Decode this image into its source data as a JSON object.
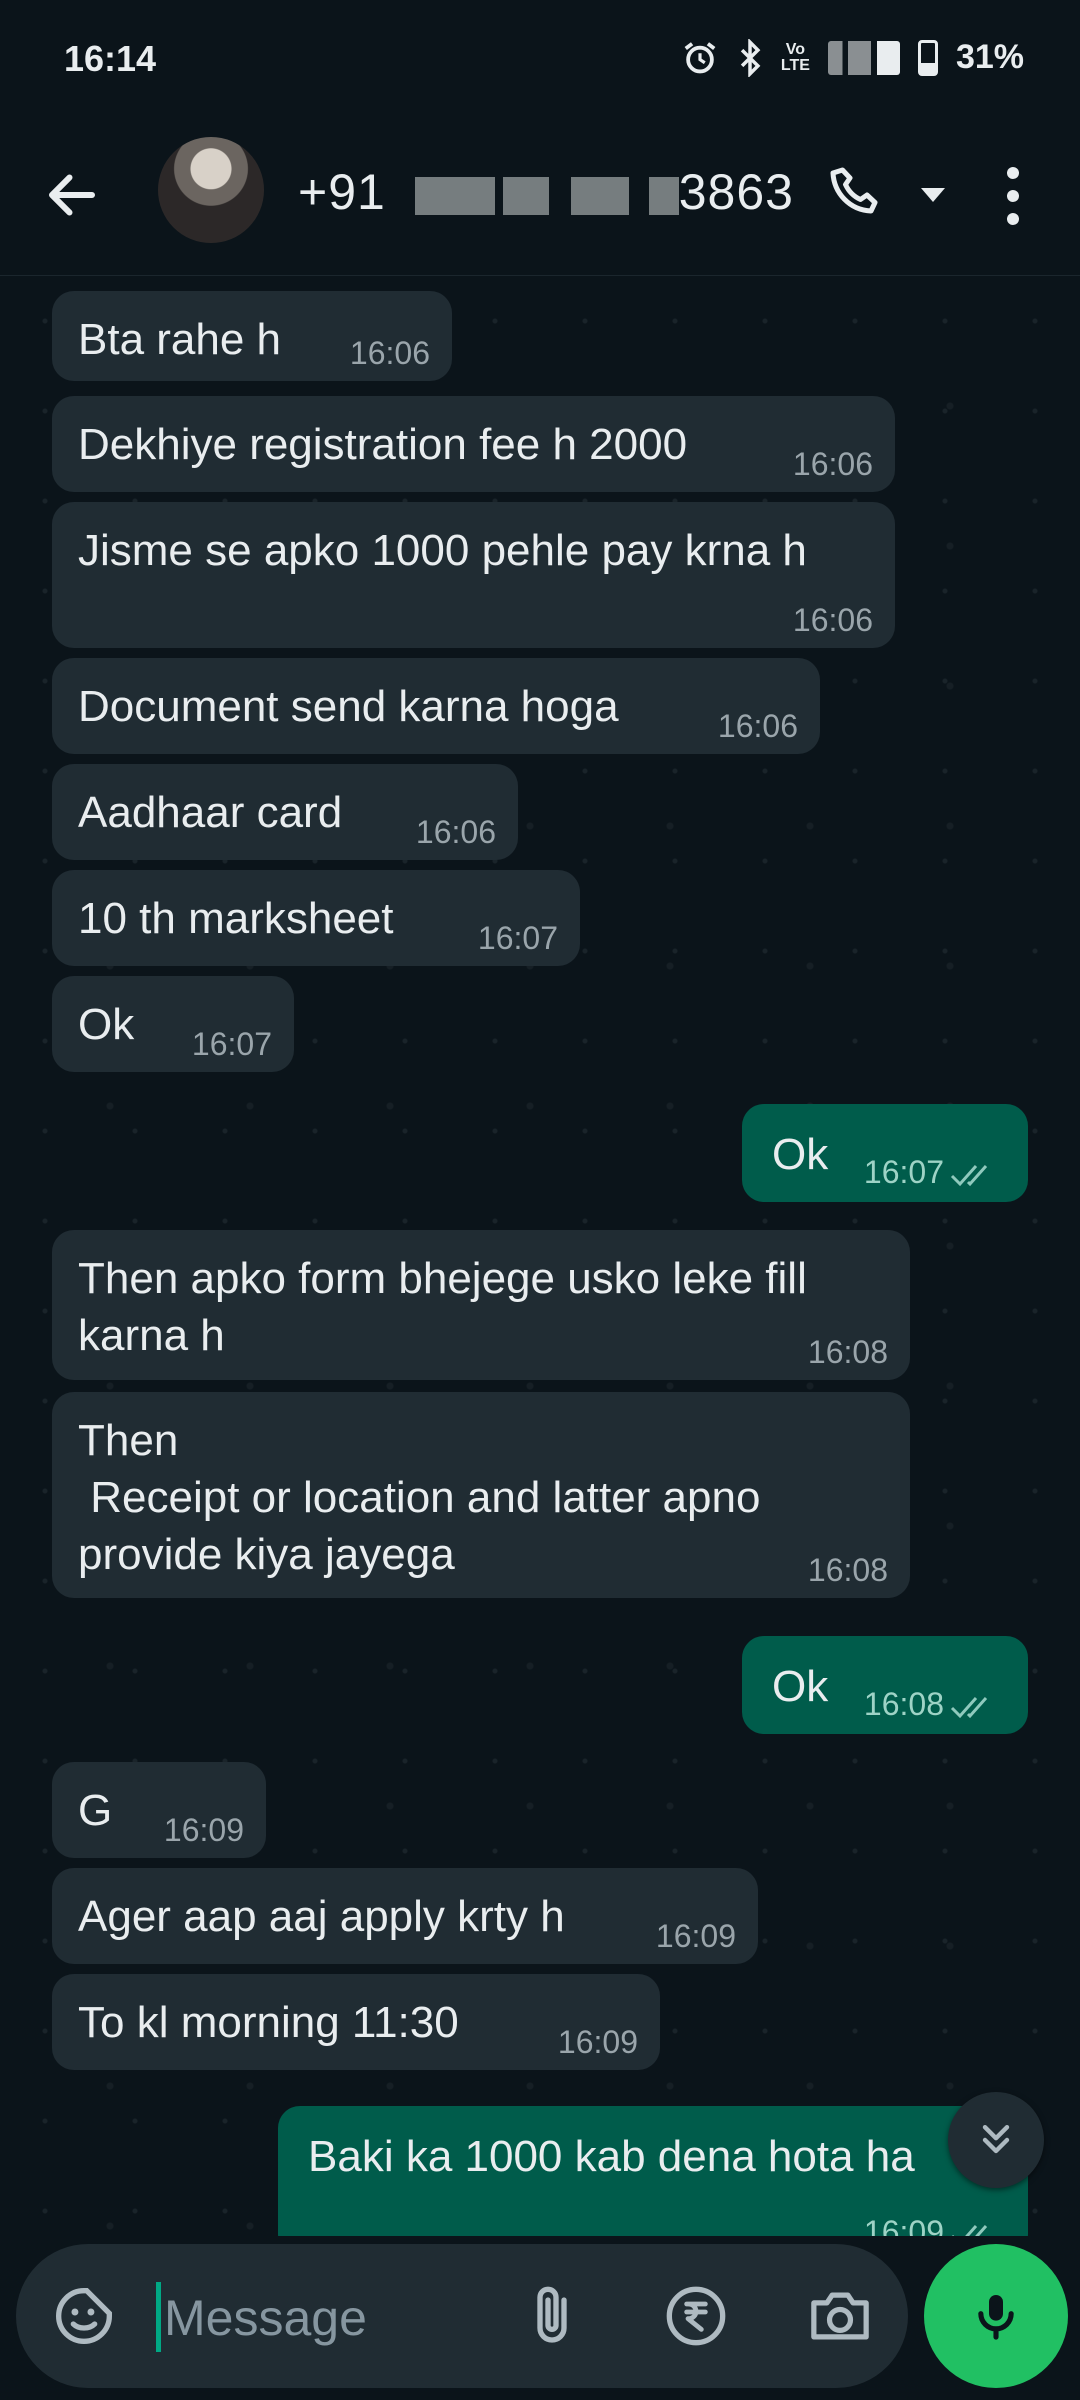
{
  "status_bar": {
    "time": "16:14",
    "volte": "Vo\nLTE",
    "battery": "31%"
  },
  "header": {
    "contact_prefix": "+91",
    "contact_suffix": "3863"
  },
  "composer": {
    "placeholder": "Message"
  },
  "colors": {
    "incoming_bubble": "#202c33",
    "outgoing_bubble": "#005c4b",
    "accent": "#21c063"
  },
  "messages": [
    {
      "dir": "in",
      "text": "Bta rahe h",
      "time": "16:06"
    },
    {
      "dir": "in",
      "text": "Dekhiye registration fee h 2000",
      "time": "16:06"
    },
    {
      "dir": "in",
      "text": "Jisme se apko 1000 pehle pay krna h",
      "time": "16:06"
    },
    {
      "dir": "in",
      "text": "Document send karna hoga",
      "time": "16:06"
    },
    {
      "dir": "in",
      "text": "Aadhaar card",
      "time": "16:06"
    },
    {
      "dir": "in",
      "text": "10 th marksheet",
      "time": "16:07"
    },
    {
      "dir": "in",
      "text": "Ok",
      "time": "16:07"
    },
    {
      "dir": "out",
      "text": "Ok",
      "time": "16:07"
    },
    {
      "dir": "in",
      "text": "Then apko form bhejege usko leke fill\nkarna h",
      "time": "16:08"
    },
    {
      "dir": "in",
      "text": "Then\n Receipt or location and latter apno\nprovide kiya jayega",
      "time": "16:08"
    },
    {
      "dir": "out",
      "text": "Ok",
      "time": "16:08"
    },
    {
      "dir": "in",
      "text": "G",
      "time": "16:09"
    },
    {
      "dir": "in",
      "text": "Ager aap aaj apply krty h",
      "time": "16:09"
    },
    {
      "dir": "in",
      "text": "To kl morning 11:30",
      "time": "16:09"
    },
    {
      "dir": "out",
      "text": "Baki ka 1000 kab dena hota ha",
      "time": "16:09"
    }
  ]
}
